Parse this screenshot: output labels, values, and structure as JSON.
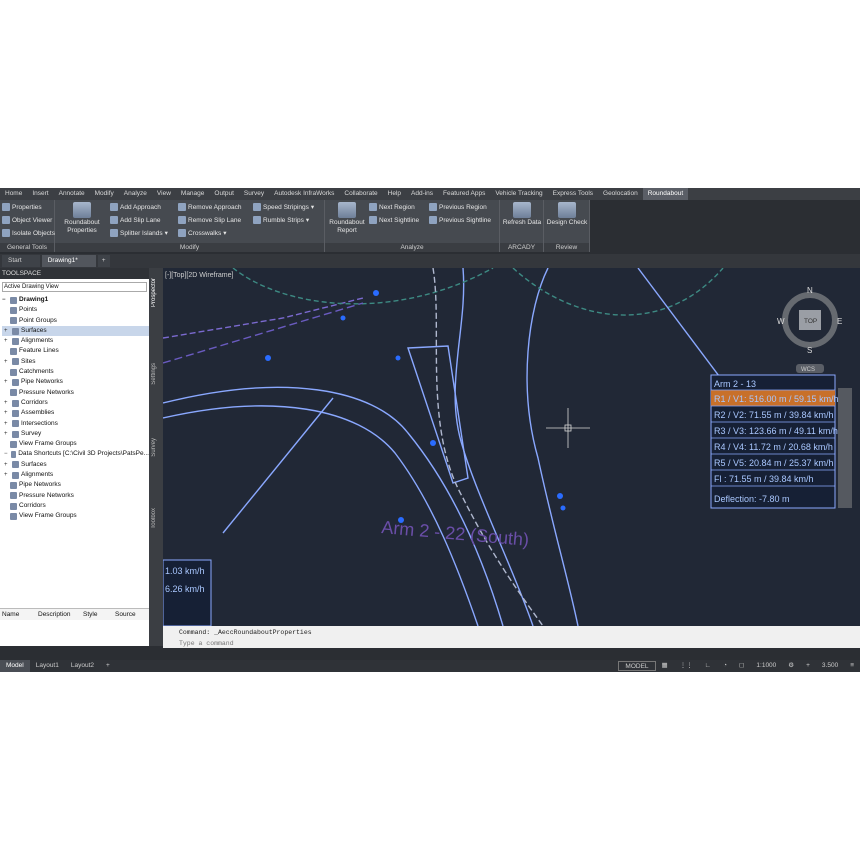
{
  "menu_tabs": [
    "Home",
    "Insert",
    "Annotate",
    "Modify",
    "Analyze",
    "View",
    "Manage",
    "Output",
    "Survey",
    "Autodesk InfraWorks",
    "Collaborate",
    "Help",
    "Add-ins",
    "Featured Apps",
    "Vehicle Tracking",
    "Express Tools",
    "Geolocation",
    "Roundabout"
  ],
  "active_tab": "Roundabout",
  "ribbon": {
    "general": {
      "properties": "Properties",
      "object_viewer": "Object Viewer",
      "isolate": "Isolate Objects",
      "label": "General Tools"
    },
    "modify": {
      "roundabout_properties": "Roundabout Properties",
      "add_approach": "Add Approach",
      "add_slip_lane": "Add Slip Lane",
      "splitter_islands": "Splitter Islands",
      "remove_approach": "Remove Approach",
      "remove_slip_lane": "Remove Slip Lane",
      "crosswalks": "Crosswalks",
      "speed_stripings": "Speed Stripings",
      "rumble_strips": "Rumble Strips",
      "label": "Modify"
    },
    "analyze": {
      "roundabout_report": "Roundabout Report",
      "next_region": "Next Region",
      "next_sightline": "Next Sightline",
      "previous_region": "Previous Region",
      "previous_sightline": "Previous Sightline",
      "label": "Analyze"
    },
    "arcady": {
      "refresh_data": "Refresh Data",
      "label": "ARCADY"
    },
    "review": {
      "design_check": "Design Check",
      "label": "Review"
    }
  },
  "doc_tabs": [
    "Start",
    "Drawing1*"
  ],
  "toolspace": {
    "title": "TOOLSPACE",
    "view": "Active Drawing View",
    "items": [
      "Drawing1",
      "Points",
      "Point Groups",
      "Surfaces",
      "Alignments",
      "Feature Lines",
      "Sites",
      "Catchments",
      "Pipe Networks",
      "Pressure Networks",
      "Corridors",
      "Assemblies",
      "Intersections",
      "Survey",
      "View Frame Groups",
      "Data Shortcuts [C:\\Civil 3D Projects\\PatsPe...",
      "Surfaces",
      "Alignments",
      "Pipe Networks",
      "Pressure Networks",
      "Corridors",
      "View Frame Groups"
    ],
    "columns": [
      "Name",
      "Description",
      "Style",
      "Source"
    ]
  },
  "side_tabs": [
    "Prospector",
    "Settings",
    "Survey",
    "Toolbox"
  ],
  "viewport": {
    "label": "[-][Top][2D Wireframe]",
    "arm_label": "Arm 2 - 22 (South)",
    "info_title": "Arm 2 - 13",
    "info_rows": [
      "R1 / V1: 516.00 m / 59.15 km/h",
      "R2 / V2: 71.55 m / 39.84 km/h",
      "R3 / V3: 123.66 m / 49.11 km/h",
      "R4 / V4: 11.72 m / 20.68 km/h",
      "R5 / V5: 20.84 m / 25.37 km/h",
      "Fl : 71.55 m / 39.84 km/h",
      "Deflection: -7.80 m"
    ],
    "left_table": [
      "1.03 km/h",
      "6.26 km/h"
    ],
    "viewcube": {
      "n": "N",
      "s": "S",
      "e": "E",
      "w": "W",
      "top": "TOP",
      "wcs": "WCS"
    }
  },
  "command": {
    "history": "Command: _AeccRoundaboutProperties",
    "placeholder": "Type a command"
  },
  "layout_tabs": [
    "Model",
    "Layout1",
    "Layout2"
  ],
  "status": {
    "model": "MODEL",
    "scale": "1:1000",
    "value": "3.500"
  },
  "colors": {
    "info_highlight": "#c8702a",
    "info_text": "#a9c7ff",
    "road_line": "#8aa8ff",
    "arm_text": "#6a4ea8"
  }
}
